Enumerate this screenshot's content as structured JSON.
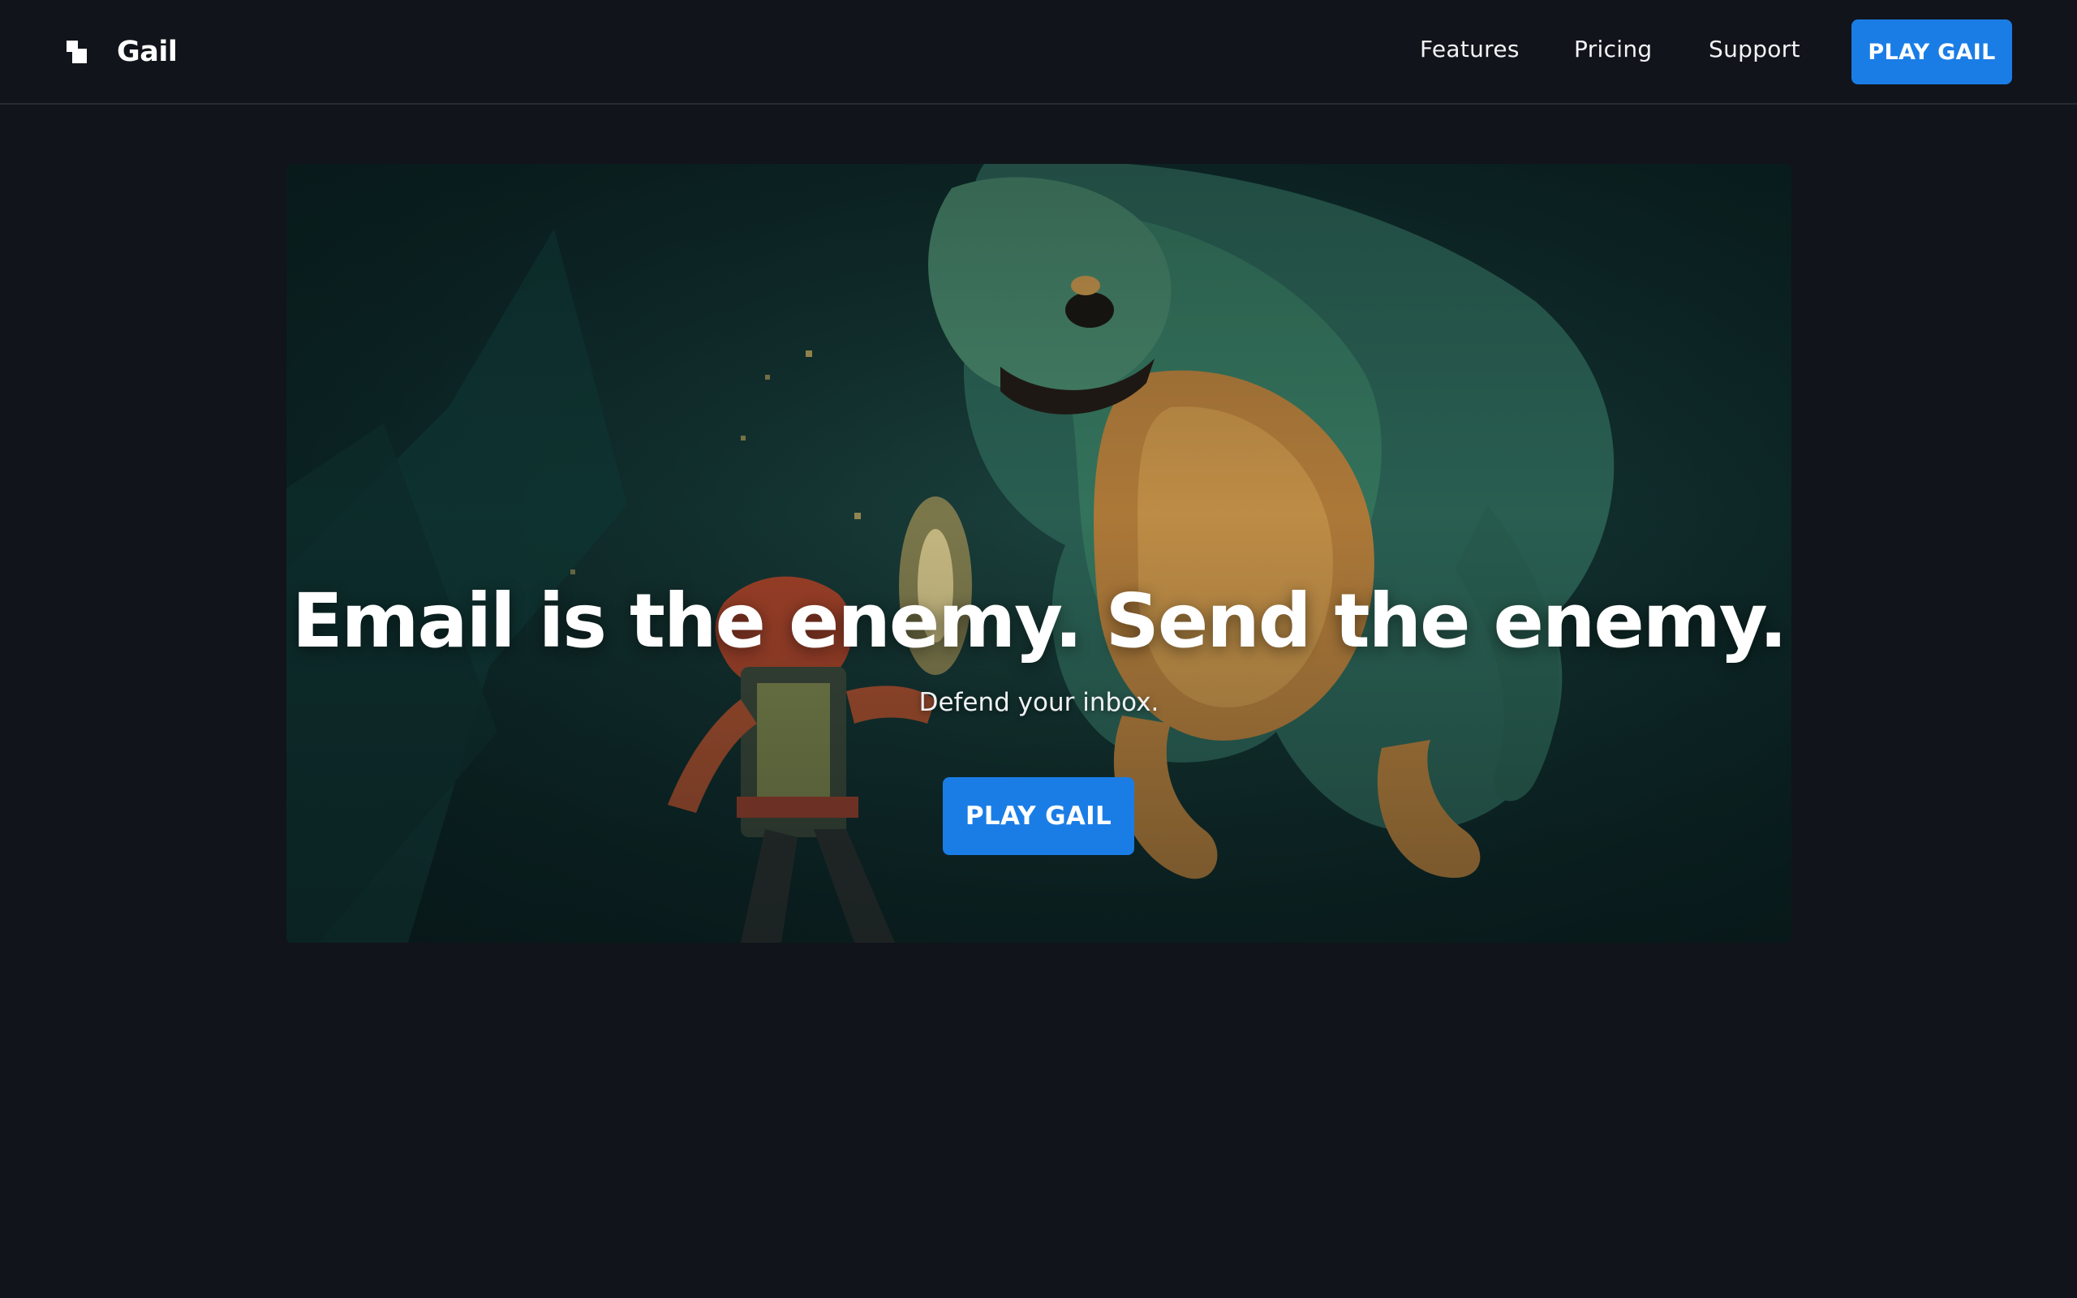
{
  "brand": {
    "name": "Gail",
    "logo_icon": "stepped-squares-logo-icon"
  },
  "nav": {
    "links": [
      {
        "label": "Features"
      },
      {
        "label": "Pricing"
      },
      {
        "label": "Support"
      }
    ],
    "cta_label": "PLAY GAIL"
  },
  "hero": {
    "title": "Email is the enemy. Send the enemy.",
    "subtitle": "Defend your inbox.",
    "cta_label": "PLAY GAIL",
    "image": "pixel-art-hero-facing-dinosaur-monster"
  },
  "colors": {
    "background": "#11141a",
    "accent": "#1a7de6",
    "nav_border": "#262a31"
  }
}
